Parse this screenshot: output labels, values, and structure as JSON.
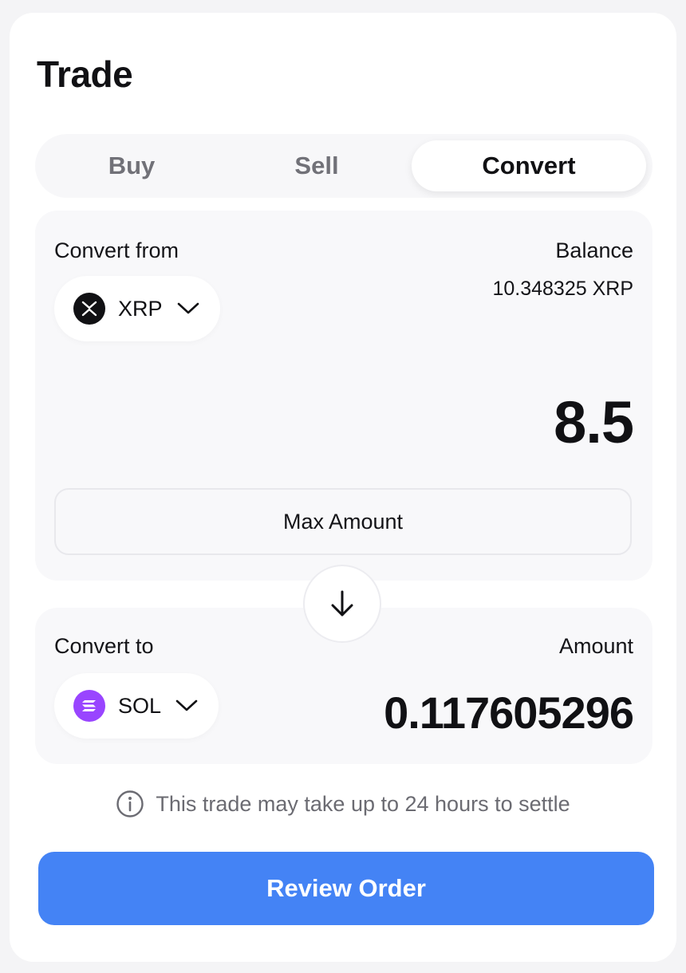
{
  "header": {
    "title": "Trade"
  },
  "tabs": [
    {
      "label": "Buy",
      "active": false
    },
    {
      "label": "Sell",
      "active": false
    },
    {
      "label": "Convert",
      "active": true
    }
  ],
  "convert_from": {
    "label": "Convert from",
    "token": {
      "symbol": "XRP",
      "icon": "xrp-coin-icon",
      "color": "#111114"
    },
    "balance_label": "Balance",
    "balance_value": "10.348325 XRP",
    "amount": "8.5",
    "max_button_label": "Max Amount"
  },
  "swap": {
    "icon": "arrow-down-icon"
  },
  "convert_to": {
    "label": "Convert to",
    "token": {
      "symbol": "SOL",
      "icon": "sol-coin-icon",
      "color": "#9945ff"
    },
    "amount_label": "Amount",
    "amount": "0.117605296"
  },
  "notice": {
    "icon": "info-icon",
    "text": "This trade may take up to 24 hours to settle"
  },
  "review_button": {
    "label": "Review Order",
    "color": "#4483f5"
  }
}
